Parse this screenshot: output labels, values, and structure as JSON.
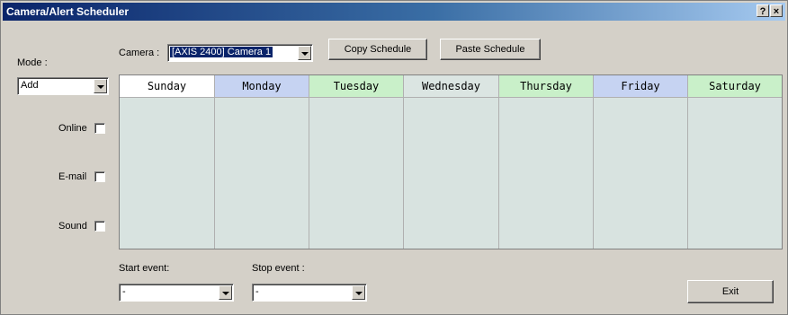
{
  "window": {
    "title": "Camera/Alert Scheduler",
    "help_button": "?",
    "close_button": "×"
  },
  "mode": {
    "label": "Mode :",
    "value": "Add"
  },
  "camera": {
    "label": "Camera :",
    "value": "[AXIS 2400] Camera 1"
  },
  "buttons": {
    "copy": "Copy Schedule",
    "paste": "Paste Schedule",
    "exit": "Exit"
  },
  "options": {
    "online": "Online",
    "email": "E-mail",
    "sound": "Sound"
  },
  "days": [
    {
      "name": "Sunday",
      "color": "#ffffff"
    },
    {
      "name": "Monday",
      "color": "#c6d3f2"
    },
    {
      "name": "Tuesday",
      "color": "#c9f0c9"
    },
    {
      "name": "Wednesday",
      "color": "#dbe5e2"
    },
    {
      "name": "Thursday",
      "color": "#c9f0c9"
    },
    {
      "name": "Friday",
      "color": "#c6d3f2"
    },
    {
      "name": "Saturday",
      "color": "#c9f0c9"
    }
  ],
  "events": {
    "start_label": "Start event:",
    "start_value": "-",
    "stop_label": "Stop event :",
    "stop_value": "-"
  }
}
